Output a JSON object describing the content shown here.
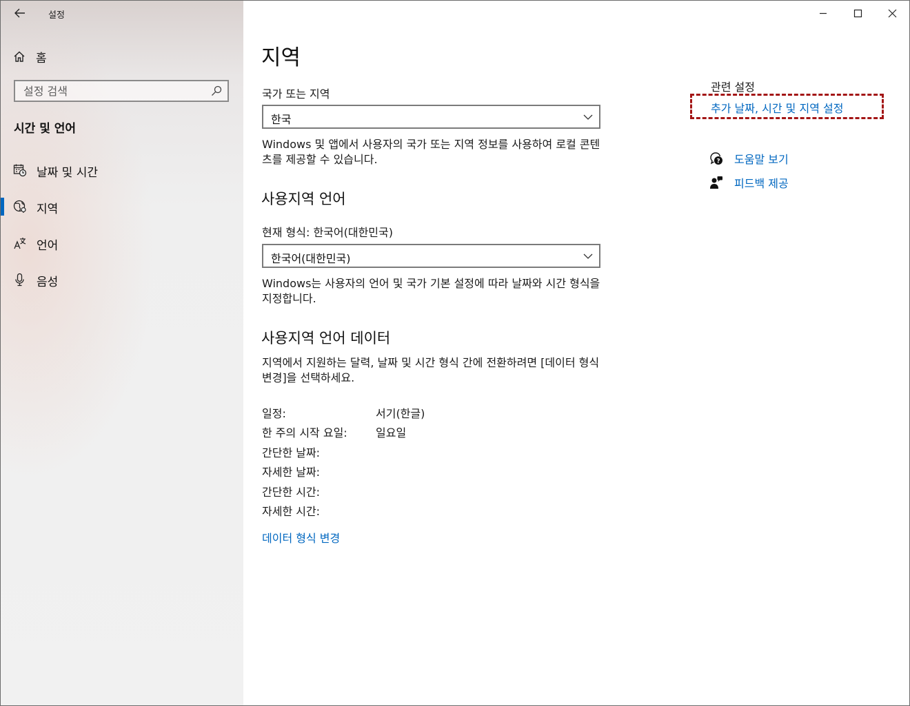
{
  "window": {
    "app_title": "설정"
  },
  "sidebar": {
    "home_label": "홈",
    "search_placeholder": "설정 검색",
    "section_title": "시간 및 언어",
    "items": [
      {
        "label": "날짜 및 시간",
        "icon": "calendar-clock-icon",
        "selected": false
      },
      {
        "label": "지역",
        "icon": "globe-icon",
        "selected": true
      },
      {
        "label": "언어",
        "icon": "language-icon",
        "selected": false
      },
      {
        "label": "음성",
        "icon": "microphone-icon",
        "selected": false
      }
    ]
  },
  "main": {
    "title": "지역",
    "country_label": "국가 또는 지역",
    "country_value": "한국",
    "country_desc": "Windows 및 앱에서 사용자의 국가 또는 지역 정보를 사용하여 로컬 콘텐츠를 제공할 수 있습니다.",
    "locale_heading": "사용지역 언어",
    "format_label": "현재 형식: 한국어(대한민국)",
    "format_value": "한국어(대한민국)",
    "format_desc": "Windows는 사용자의 언어 및 국가 기본 설정에 따라 날짜와 시간 형식을 지정합니다.",
    "data_heading": "사용지역 언어 데이터",
    "data_desc": "지역에서 지원하는 달력, 날짜 및 시간 형식 간에 전환하려면 [데이터 형식 변경]을 선택하세요.",
    "data_rows": [
      {
        "key": "일정:",
        "value": "서기(한글)"
      },
      {
        "key": "한 주의 시작 요일:",
        "value": "일요일"
      },
      {
        "key": "간단한 날짜:",
        "value": ""
      },
      {
        "key": "자세한 날짜:",
        "value": ""
      },
      {
        "key": "간단한 시간:",
        "value": ""
      },
      {
        "key": "자세한 시간:",
        "value": ""
      }
    ],
    "change_format_link": "데이터 형식 변경"
  },
  "related": {
    "title": "관련 설정",
    "additional_link": "추가 날짜, 시간 및 지역 설정",
    "help_link": "도움말 보기",
    "feedback_link": "피드백 제공"
  },
  "colors": {
    "accent": "#0067c0",
    "highlight": "#a31515"
  }
}
